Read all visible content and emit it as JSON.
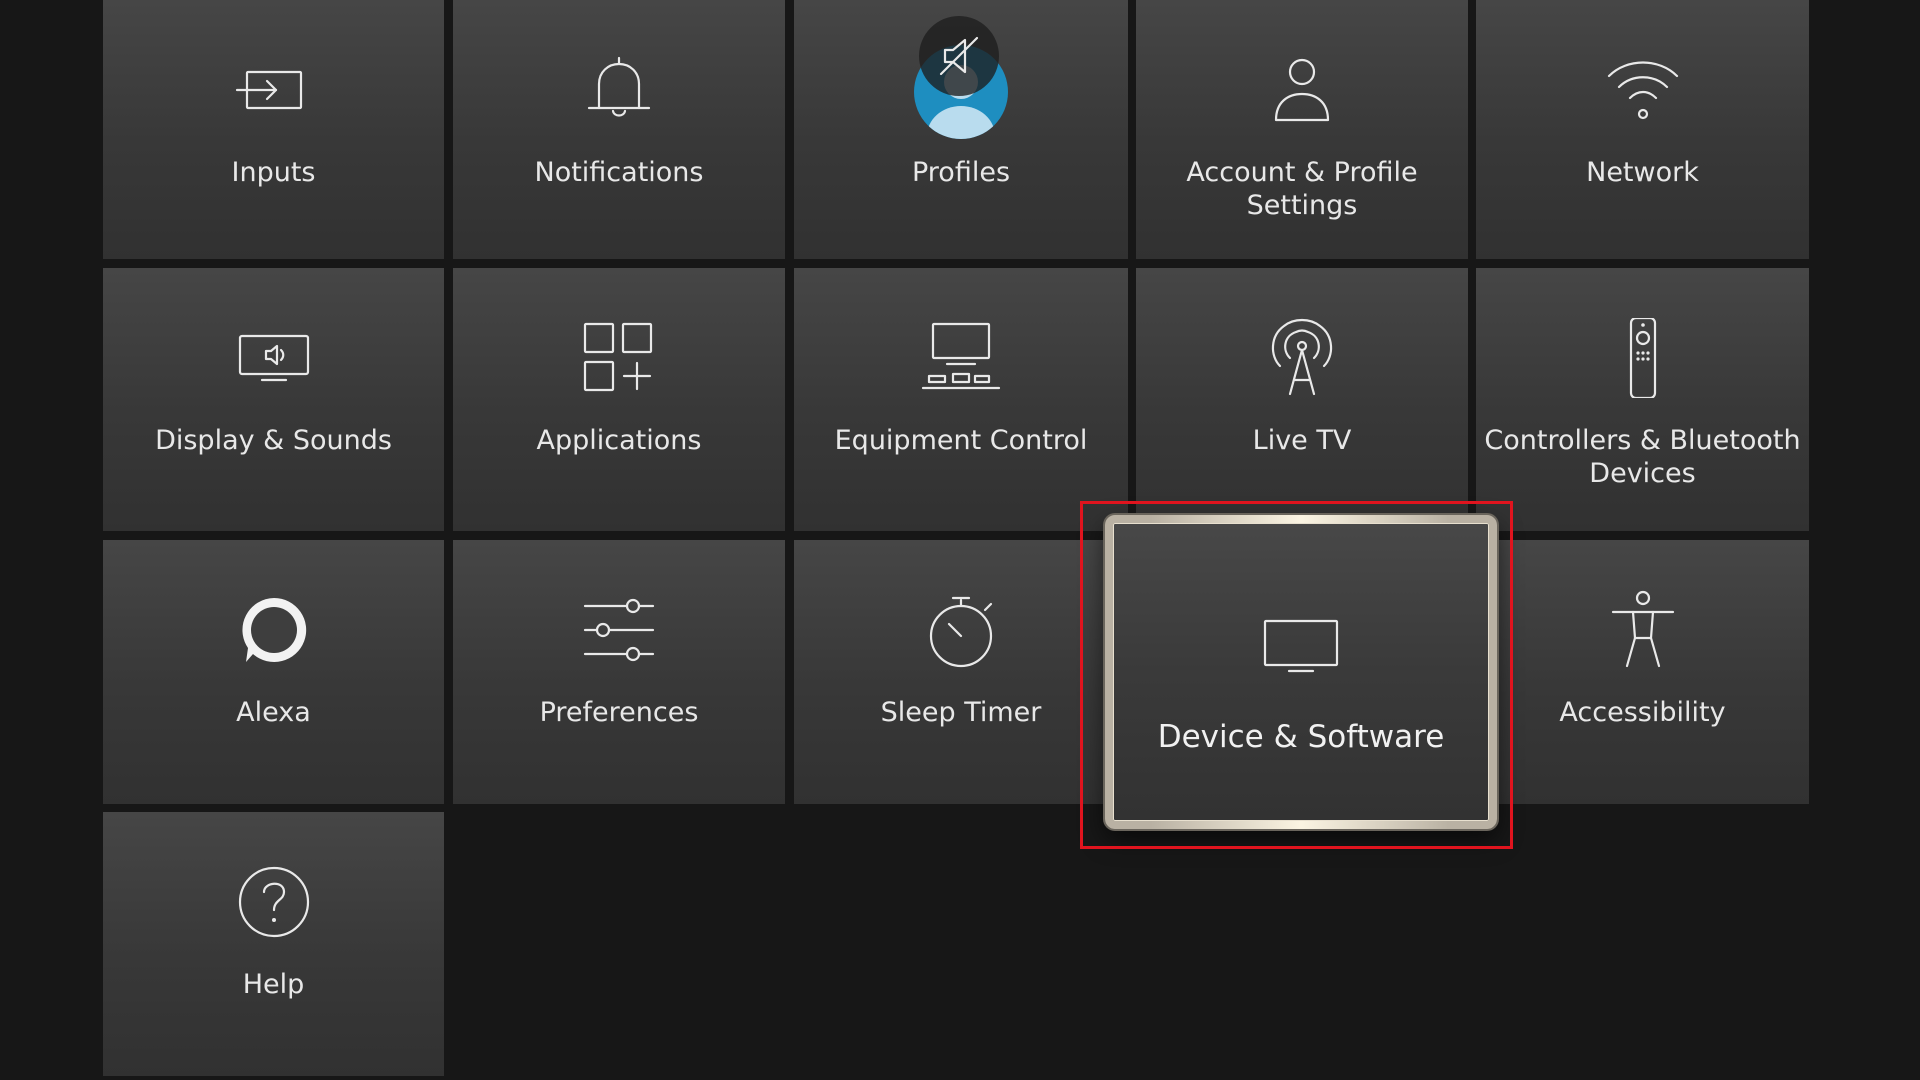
{
  "settings_tiles": [
    {
      "label": "Inputs",
      "icon": "input-icon"
    },
    {
      "label": "Notifications",
      "icon": "bell-icon"
    },
    {
      "label": "Profiles",
      "icon": "profile-avatar-icon"
    },
    {
      "label": "Account & Profile Settings",
      "icon": "person-icon"
    },
    {
      "label": "Network",
      "icon": "wifi-icon"
    },
    {
      "label": "Display & Sounds",
      "icon": "tv-speaker-icon"
    },
    {
      "label": "Applications",
      "icon": "apps-grid-icon"
    },
    {
      "label": "Equipment Control",
      "icon": "equipment-icon"
    },
    {
      "label": "Live TV",
      "icon": "antenna-icon"
    },
    {
      "label": "Controllers & Bluetooth Devices",
      "icon": "remote-icon"
    },
    {
      "label": "Alexa",
      "icon": "alexa-ring-icon"
    },
    {
      "label": "Preferences",
      "icon": "sliders-icon"
    },
    {
      "label": "Sleep Timer",
      "icon": "stopwatch-icon"
    },
    {
      "label": "Device & Software",
      "icon": "tv-icon"
    },
    {
      "label": "Accessibility",
      "icon": "accessibility-icon"
    },
    {
      "label": "Help",
      "icon": "help-icon"
    }
  ],
  "focused_tile": "Device & Software",
  "colors": {
    "background": "#171717",
    "tile": "#3c3c3c",
    "focus_border": "#b9b1a3",
    "highlight_outline": "#e0141e",
    "profile_avatar": "#1e8ec0"
  }
}
